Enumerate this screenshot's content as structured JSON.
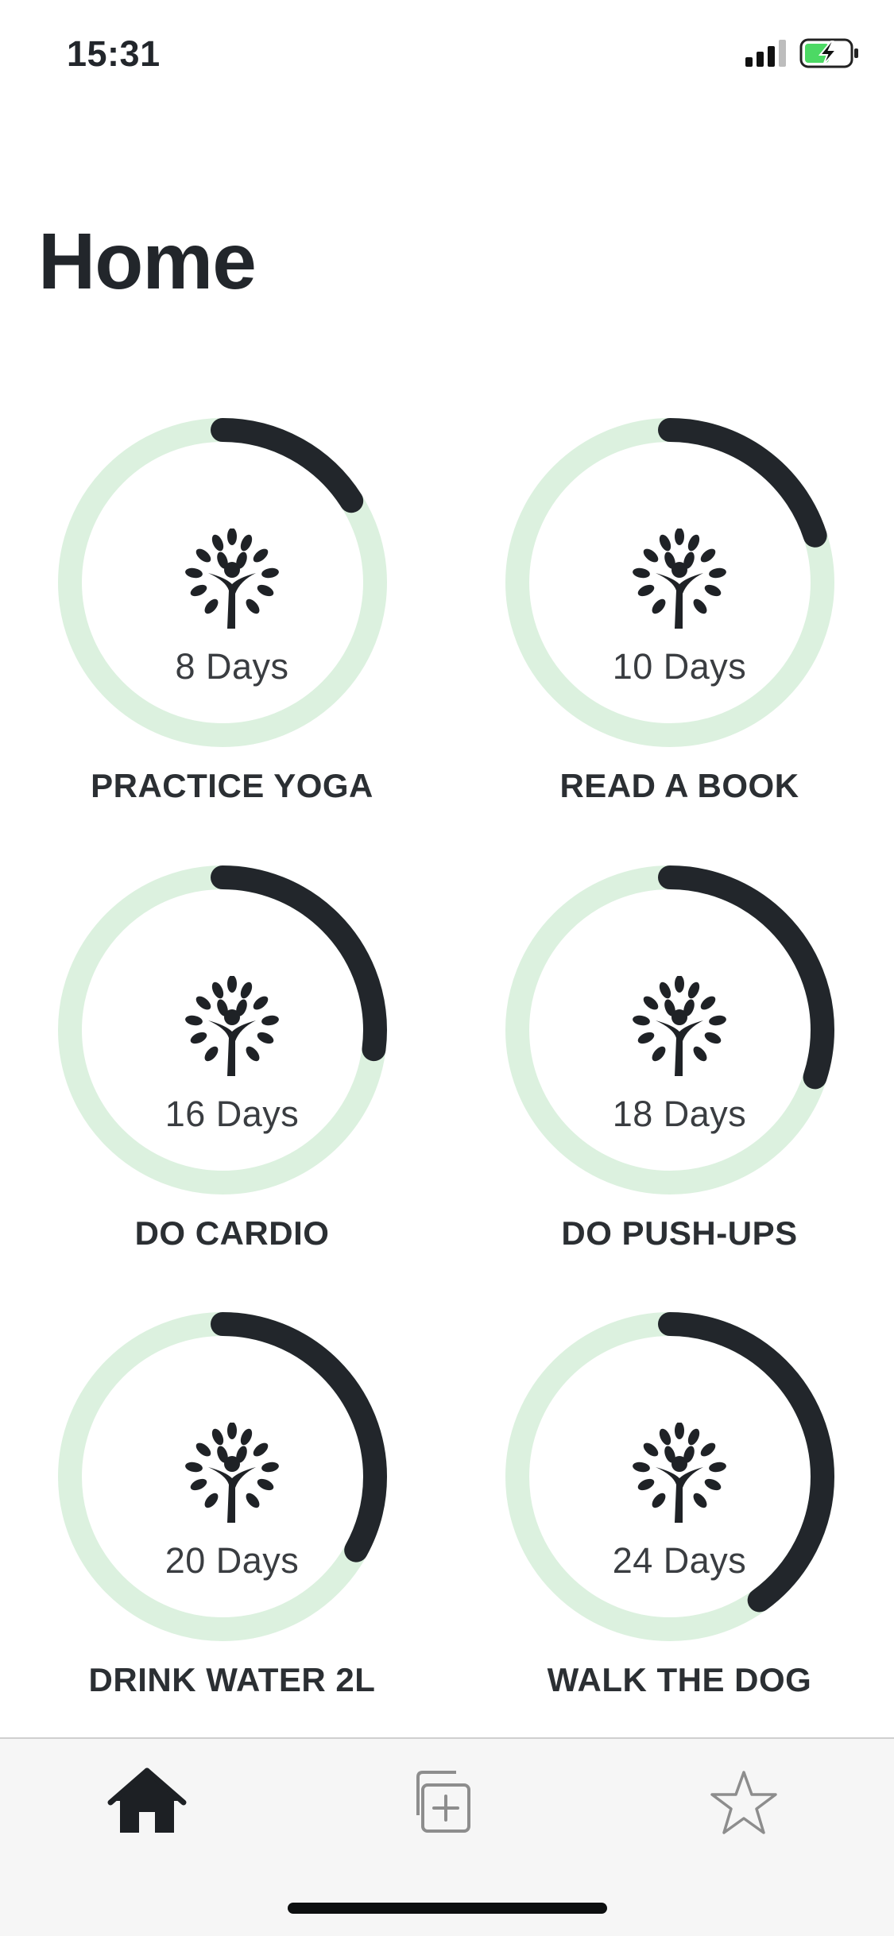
{
  "status_bar": {
    "time": "15:31",
    "icons": [
      "cellular-signal-icon",
      "battery-charging-icon"
    ],
    "battery_color": "#4cd964"
  },
  "page": {
    "title": "Home"
  },
  "colors": {
    "ring_track": "#dcf1df",
    "ring_progress": "#22262b"
  },
  "habits": [
    {
      "name": "PRACTICE YOGA",
      "days_label": "8 Days",
      "progress": 0.16,
      "icon": "tree-person-icon"
    },
    {
      "name": "READ A BOOK",
      "days_label": "10 Days",
      "progress": 0.2,
      "icon": "tree-person-icon"
    },
    {
      "name": "DO CARDIO",
      "days_label": "16 Days",
      "progress": 0.27,
      "icon": "tree-person-icon"
    },
    {
      "name": "DO PUSH-UPS",
      "days_label": "18 Days",
      "progress": 0.3,
      "icon": "tree-person-icon"
    },
    {
      "name": "DRINK WATER 2L",
      "days_label": "20 Days",
      "progress": 0.33,
      "icon": "tree-person-icon"
    },
    {
      "name": "WALK THE DOG",
      "days_label": "24 Days",
      "progress": 0.4,
      "icon": "tree-person-icon"
    }
  ],
  "tab_bar": {
    "tabs": [
      {
        "name": "home",
        "icon": "home-icon",
        "active": true
      },
      {
        "name": "add",
        "icon": "add-icon",
        "active": false
      },
      {
        "name": "favorites",
        "icon": "star-icon",
        "active": false
      }
    ]
  }
}
